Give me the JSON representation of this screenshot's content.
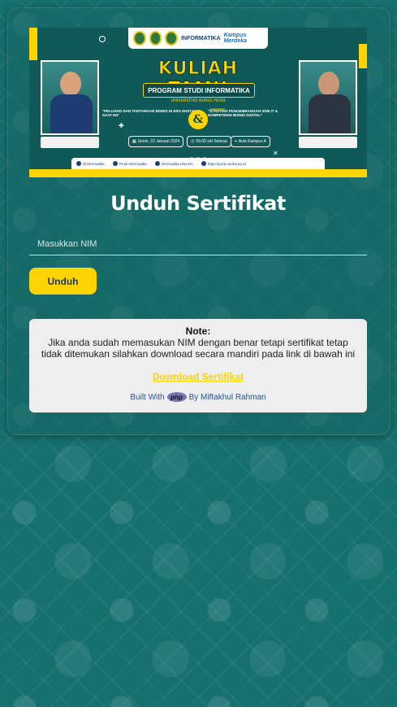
{
  "banner": {
    "top_label": "INFORMATIKA",
    "top_brand": "Kampus Merdeka",
    "title": "KULIAH TAMU",
    "subtitle": "PROGRAM STUDI INFORMATIKA",
    "university": "UNIVERSITAS NURUL HUDA",
    "topic_left": "\"PELUANG DAN TANTANGAN BISNIS DI ERA DIGITAL SAAT INI\"",
    "topic_right": "\"STRATEGI PENGEMBANGAN SDM IT & KOMPETENSI BISNIS DIGITAL\"",
    "ampersand": "&",
    "date": "Senin, 22 Januari 2024",
    "time": "09.00 s/d Selesai",
    "place": "Aula Kampus A",
    "footer_items": [
      "@informatika",
      "Prodi Informatika",
      "informatika.UNUHA",
      "https://pmb.unuha.ac.id"
    ]
  },
  "page": {
    "heading": "Unduh Sertifikat"
  },
  "form": {
    "nim_placeholder": "Masukkan NIM",
    "nim_value": "",
    "submit_label": "Unduh"
  },
  "note": {
    "title": "Note:",
    "text": "Jika anda sudah memasukan NIM dengan benar tetapi sertifikat tetap tidak ditemukan silahkan download secara mandiri pada link di bawah ini",
    "link_label": "Download Sertifikat",
    "built_prefix": "Built With",
    "php_label": "php",
    "built_suffix": "By Miftakhul Rahman"
  },
  "colors": {
    "background": "#16706e",
    "accent": "#ffd400",
    "note_bg": "#eeeeee",
    "link": "#ffd400"
  }
}
